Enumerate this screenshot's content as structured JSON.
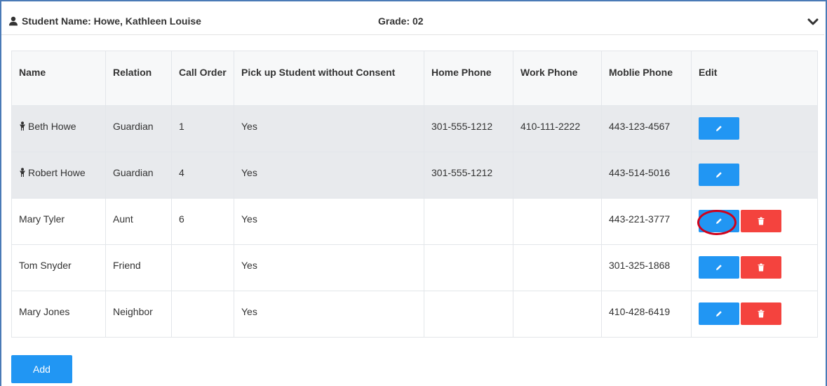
{
  "header": {
    "student_label": "Student Name: Howe, Kathleen Louise",
    "grade_label": "Grade: 02"
  },
  "table": {
    "columns": [
      "Name",
      "Relation",
      "Call Order",
      "Pick up Student without Consent",
      "Home Phone",
      "Work Phone",
      "Moblie Phone",
      "Edit"
    ],
    "rows": [
      {
        "name": "Beth Howe",
        "relation": "Guardian",
        "call_order": "1",
        "pickup": "Yes",
        "home": "301-555-1212",
        "work": "410-111-2222",
        "mobile": "443-123-4567",
        "primary": true,
        "deletable": false
      },
      {
        "name": "Robert Howe",
        "relation": "Guardian",
        "call_order": "4",
        "pickup": "Yes",
        "home": "301-555-1212",
        "work": "",
        "mobile": "443-514-5016",
        "primary": true,
        "deletable": false
      },
      {
        "name": "Mary Tyler",
        "relation": "Aunt",
        "call_order": "6",
        "pickup": "Yes",
        "home": "",
        "work": "",
        "mobile": "443-221-3777",
        "primary": false,
        "deletable": true,
        "highlighted": true
      },
      {
        "name": "Tom Snyder",
        "relation": "Friend",
        "call_order": "",
        "pickup": "Yes",
        "home": "",
        "work": "",
        "mobile": "301-325-1868",
        "primary": false,
        "deletable": true
      },
      {
        "name": "Mary Jones",
        "relation": "Neighbor",
        "call_order": "",
        "pickup": "Yes",
        "home": "",
        "work": "",
        "mobile": "410-428-6419",
        "primary": false,
        "deletable": true
      }
    ]
  },
  "add_label": "Add",
  "colors": {
    "edit_button": "#2196f3",
    "delete_button": "#f4433e",
    "primary_row_bg": "#e8eaed",
    "highlight_ring": "#d0021b",
    "frame_border": "#4a7ab6"
  },
  "icons": {
    "header": "user-icon",
    "collapse": "chevron-down-icon",
    "primary_guardian": "person-icon",
    "edit": "pencil-icon",
    "delete": "trash-icon"
  }
}
